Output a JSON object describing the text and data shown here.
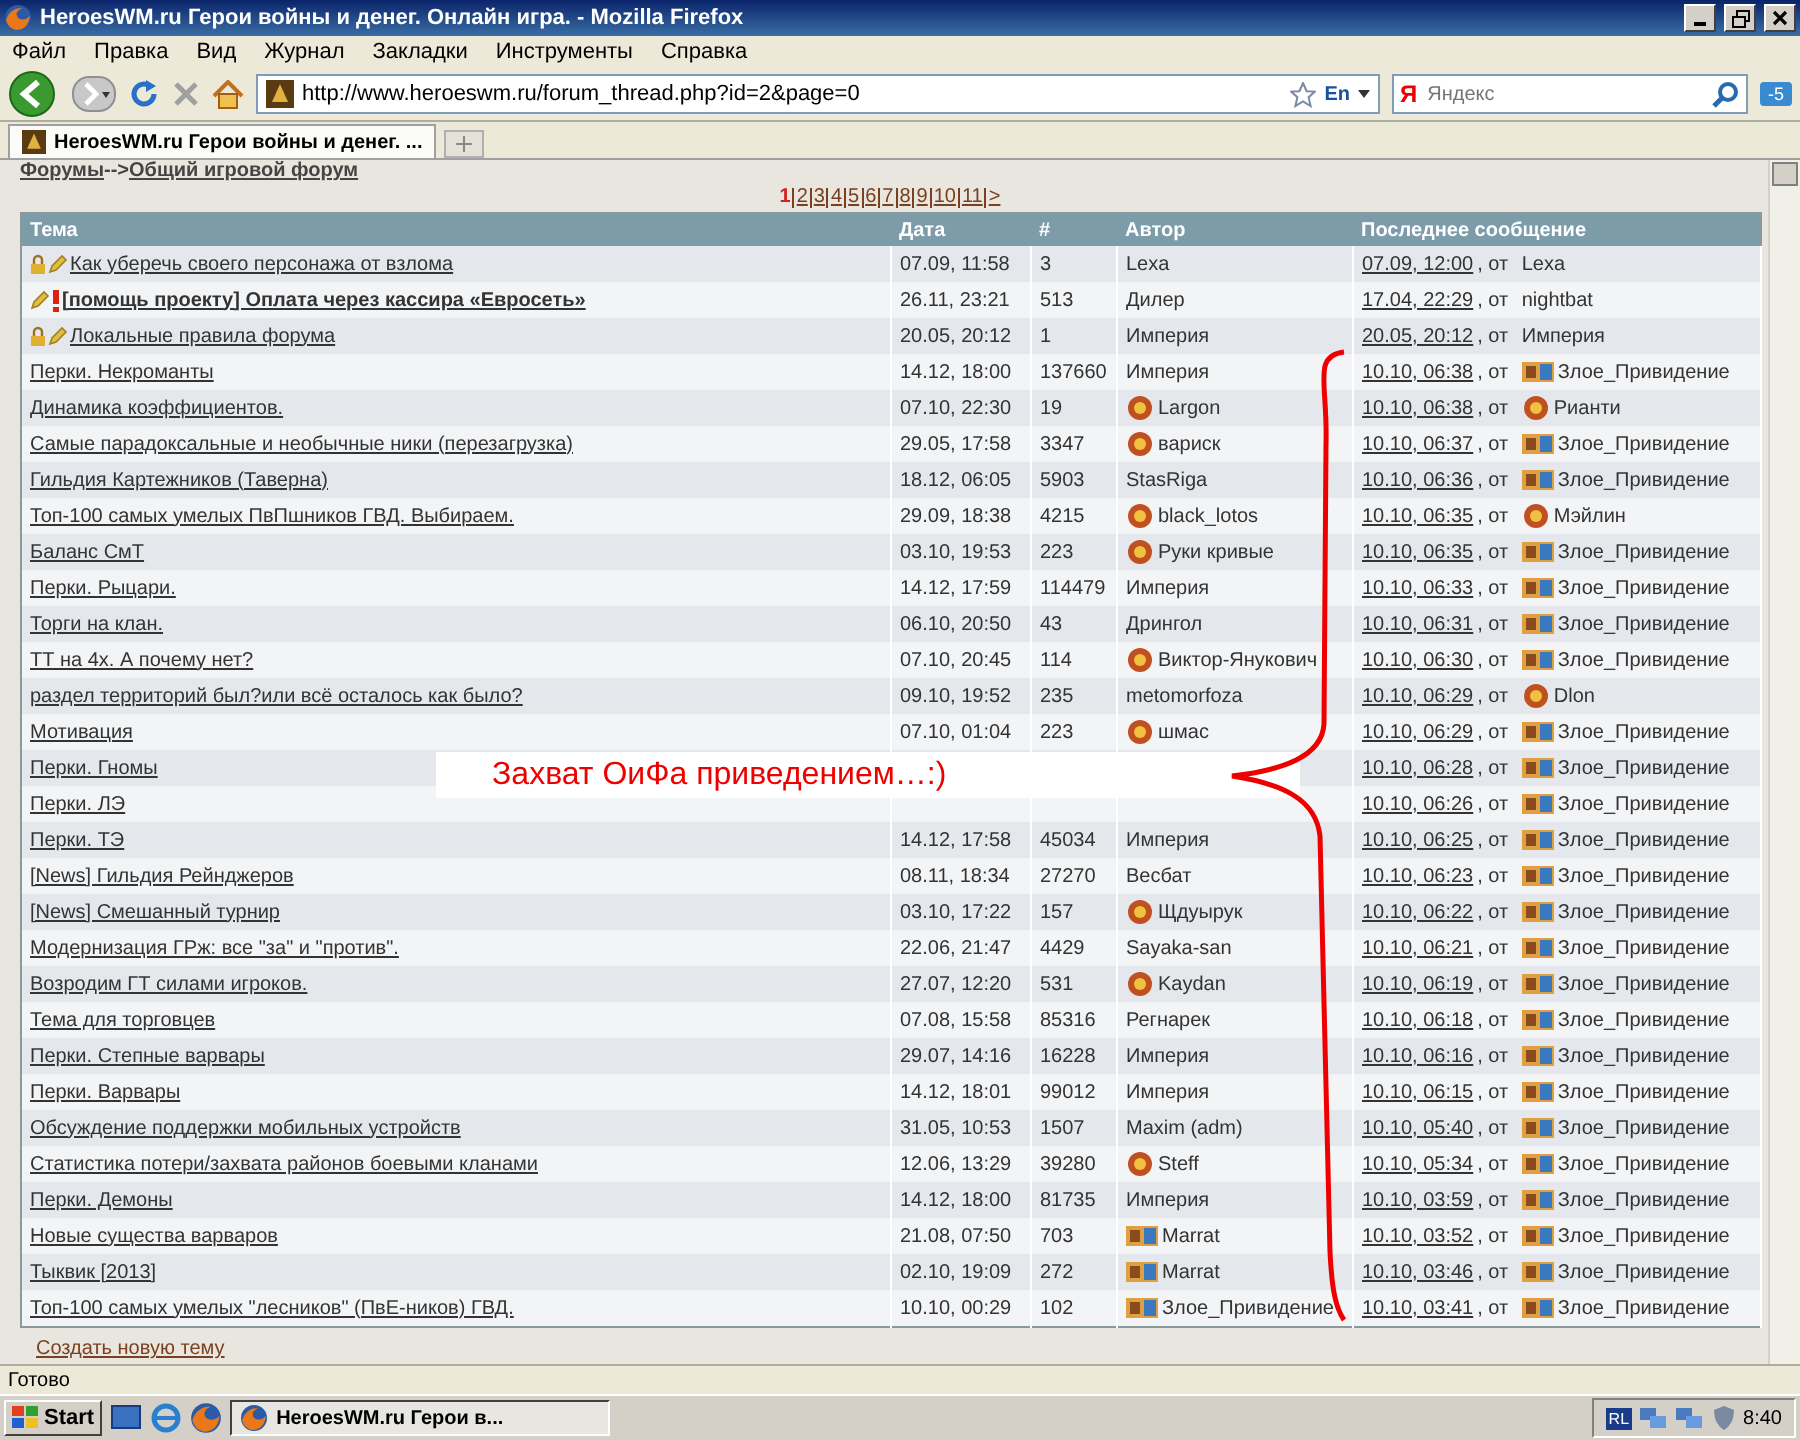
{
  "window": {
    "title": "HeroesWM.ru Герои войны и денег. Онлайн игра. - Mozilla Firefox"
  },
  "menu": [
    "Файл",
    "Правка",
    "Вид",
    "Журнал",
    "Закладки",
    "Инструменты",
    "Справка"
  ],
  "toolbar": {
    "url": "http://www.heroeswm.ru/forum_thread.php?id=2&page=0",
    "lang": "En",
    "search_logo": "Я",
    "search_placeholder": "Яндекс",
    "badge": "-5"
  },
  "tabs": [
    {
      "label": "HeroesWM.ru Герои войны и денег. ...",
      "selected": true
    }
  ],
  "breadcrumb": {
    "root": "Форумы",
    "sep": "-->",
    "current": "Общий игровой форум"
  },
  "pages": {
    "items": [
      {
        "label": "1",
        "selected": true
      },
      {
        "label": "2",
        "selected": false
      },
      {
        "label": "3",
        "selected": false
      },
      {
        "label": "4",
        "selected": false
      },
      {
        "label": "5",
        "selected": false
      },
      {
        "label": "6",
        "selected": false
      },
      {
        "label": "7",
        "selected": false
      },
      {
        "label": "8",
        "selected": false
      },
      {
        "label": "9",
        "selected": false
      },
      {
        "label": "10",
        "selected": false
      },
      {
        "label": "11",
        "selected": false
      }
    ],
    "next": ">"
  },
  "table": {
    "columns": [
      "Тема",
      "Дата",
      "#",
      "Автор",
      "Последнее сообщение"
    ],
    "rows": [
      {
        "kind": "locked",
        "title": "Как уберечь своего персонажа от взлома",
        "date": "07.09, 11:58",
        "count": "3",
        "author": {
          "kind": "plain",
          "name": "Lexa"
        },
        "last": {
          "time": "07.09, 12:00",
          "sep": ", от",
          "kind": "plain",
          "author": "Lexa"
        }
      },
      {
        "kind": "important",
        "title": "[помощь проекту] Оплата через кассира «Евросеть»",
        "date": "26.11, 23:21",
        "count": "513",
        "author": {
          "kind": "plain",
          "name": "Дилер"
        },
        "last": {
          "time": "17.04, 22:29",
          "sep": ", от",
          "kind": "plain",
          "author": "nightbat"
        }
      },
      {
        "kind": "locked",
        "title": "Локальные правила форума",
        "date": "20.05, 20:12",
        "count": "1",
        "author": {
          "kind": "plain",
          "name": "Империя"
        },
        "last": {
          "time": "20.05, 20:12",
          "sep": ", от",
          "kind": "plain",
          "author": "Империя"
        }
      },
      {
        "kind": "topic",
        "title": "Перки. Некроманты",
        "date": "14.12, 18:00",
        "count": "137660",
        "author": {
          "kind": "plain",
          "name": "Империя"
        },
        "last": {
          "time": "10.10, 06:38",
          "sep": ", от",
          "kind": "clan",
          "author": "Злое_Привидение"
        }
      },
      {
        "kind": "topic",
        "title": "Динамика коэффициентов.",
        "date": "07.10, 22:30",
        "count": "19",
        "author": {
          "kind": "emblem",
          "name": "Largon"
        },
        "last": {
          "time": "10.10, 06:38",
          "sep": ", от",
          "kind": "emblem",
          "author": "Рианти"
        }
      },
      {
        "kind": "topic",
        "title": "Самые парадоксальные и необычные ники (перезагрузка)",
        "date": "29.05, 17:58",
        "count": "3347",
        "author": {
          "kind": "emblem",
          "name": "вариск"
        },
        "last": {
          "time": "10.10, 06:37",
          "sep": ", от",
          "kind": "clan",
          "author": "Злое_Привидение"
        }
      },
      {
        "kind": "topic",
        "title": "Гильдия Картежников (Таверна)",
        "date": "18.12, 06:05",
        "count": "5903",
        "author": {
          "kind": "plain",
          "name": "StasRiga"
        },
        "last": {
          "time": "10.10, 06:36",
          "sep": ", от",
          "kind": "clan",
          "author": "Злое_Привидение"
        }
      },
      {
        "kind": "topic",
        "title": "Топ-100 самых умелых ПвПшников ГВД. Выбираем.",
        "date": "29.09, 18:38",
        "count": "4215",
        "author": {
          "kind": "emblem",
          "name": "black_lotos"
        },
        "last": {
          "time": "10.10, 06:35",
          "sep": ", от",
          "kind": "emblem",
          "author": "Мэйлин"
        }
      },
      {
        "kind": "topic",
        "title": "Баланс СмТ",
        "date": "03.10, 19:53",
        "count": "223",
        "author": {
          "kind": "emblem",
          "name": "Руки кривые"
        },
        "last": {
          "time": "10.10, 06:35",
          "sep": ", от",
          "kind": "clan",
          "author": "Злое_Привидение"
        }
      },
      {
        "kind": "topic",
        "title": "Перки. Рыцари.",
        "date": "14.12, 17:59",
        "count": "114479",
        "author": {
          "kind": "plain",
          "name": "Империя"
        },
        "last": {
          "time": "10.10, 06:33",
          "sep": ", от",
          "kind": "clan",
          "author": "Злое_Привидение"
        }
      },
      {
        "kind": "topic",
        "title": "Торги на клан.",
        "date": "06.10, 20:50",
        "count": "43",
        "author": {
          "kind": "plain",
          "name": "Дрингол"
        },
        "last": {
          "time": "10.10, 06:31",
          "sep": ", от",
          "kind": "clan",
          "author": "Злое_Привидение"
        }
      },
      {
        "kind": "topic",
        "title": "ТТ на 4х. А почему нет?",
        "date": "07.10, 20:45",
        "count": "114",
        "author": {
          "kind": "emblem",
          "name": "Виктор-Янукович"
        },
        "last": {
          "time": "10.10, 06:30",
          "sep": ", от",
          "kind": "clan",
          "author": "Злое_Привидение"
        }
      },
      {
        "kind": "topic",
        "title": "раздел территорий был?или всё осталось как было?",
        "date": "09.10, 19:52",
        "count": "235",
        "author": {
          "kind": "plain",
          "name": "metomorfoza"
        },
        "last": {
          "time": "10.10, 06:29",
          "sep": ", от",
          "kind": "emblem",
          "author": "Dlon"
        }
      },
      {
        "kind": "topic",
        "title": "Мотивация",
        "date": "07.10, 01:04",
        "count": "223",
        "author": {
          "kind": "emblem",
          "name": "шмас"
        },
        "last": {
          "time": "10.10, 06:29",
          "sep": ", от",
          "kind": "clan",
          "author": "Злое_Привидение"
        }
      },
      {
        "kind": "topic",
        "title": "Перки. Гномы",
        "last": {
          "time": "10.10, 06:28",
          "sep": ", от",
          "kind": "clan",
          "author": "Злое_Привидение"
        }
      },
      {
        "kind": "topic",
        "title": "Перки. ЛЭ",
        "last": {
          "time": "10.10, 06:26",
          "sep": ", от",
          "kind": "clan",
          "author": "Злое_Привидение"
        }
      },
      {
        "kind": "topic",
        "title": "Перки. ТЭ",
        "date": "14.12, 17:58",
        "count": "45034",
        "author": {
          "kind": "plain",
          "name": "Империя"
        },
        "last": {
          "time": "10.10, 06:25",
          "sep": ", от",
          "kind": "clan",
          "author": "Злое_Привидение"
        }
      },
      {
        "kind": "topic",
        "title": "[News] Гильдия Рейнджеров",
        "date": "08.11, 18:34",
        "count": "27270",
        "author": {
          "kind": "plain",
          "name": "Весбат"
        },
        "last": {
          "time": "10.10, 06:23",
          "sep": ", от",
          "kind": "clan",
          "author": "Злое_Привидение"
        }
      },
      {
        "kind": "topic",
        "title": "[News] Смешанный турнир",
        "date": "03.10, 17:22",
        "count": "157",
        "author": {
          "kind": "emblem",
          "name": "Щдуырук"
        },
        "last": {
          "time": "10.10, 06:22",
          "sep": ", от",
          "kind": "clan",
          "author": "Злое_Привидение"
        }
      },
      {
        "kind": "topic",
        "title": "Модернизация ГРж: все \"за\" и \"против\".",
        "date": "22.06, 21:47",
        "count": "4429",
        "author": {
          "kind": "plain",
          "name": "Sayaka-san"
        },
        "last": {
          "time": "10.10, 06:21",
          "sep": ", от",
          "kind": "clan",
          "author": "Злое_Привидение"
        }
      },
      {
        "kind": "topic",
        "title": "Возродим ГТ силами игроков.",
        "date": "27.07, 12:20",
        "count": "531",
        "author": {
          "kind": "emblem",
          "name": "Kaydan"
        },
        "last": {
          "time": "10.10, 06:19",
          "sep": ", от",
          "kind": "clan",
          "author": "Злое_Привидение"
        }
      },
      {
        "kind": "topic",
        "title": "Тема для торговцев",
        "date": "07.08, 15:58",
        "count": "85316",
        "author": {
          "kind": "plain",
          "name": "Регнарек"
        },
        "last": {
          "time": "10.10, 06:18",
          "sep": ", от",
          "kind": "clan",
          "author": "Злое_Привидение"
        }
      },
      {
        "kind": "topic",
        "title": "Перки. Степные варвары",
        "date": "29.07, 14:16",
        "count": "16228",
        "author": {
          "kind": "plain",
          "name": "Империя"
        },
        "last": {
          "time": "10.10, 06:16",
          "sep": ", от",
          "kind": "clan",
          "author": "Злое_Привидение"
        }
      },
      {
        "kind": "topic",
        "title": "Перки. Варвары",
        "date": "14.12, 18:01",
        "count": "99012",
        "author": {
          "kind": "plain",
          "name": "Империя"
        },
        "last": {
          "time": "10.10, 06:15",
          "sep": ", от",
          "kind": "clan",
          "author": "Злое_Привидение"
        }
      },
      {
        "kind": "topic",
        "title": "Обсуждение поддержки мобильных устройств",
        "date": "31.05, 10:53",
        "count": "1507",
        "author": {
          "kind": "plain",
          "name": "Maxim (adm)"
        },
        "last": {
          "time": "10.10, 05:40",
          "sep": ", от",
          "kind": "clan",
          "author": "Злое_Привидение"
        }
      },
      {
        "kind": "topic",
        "title": "Статистика потери/захвата районов боевыми кланами",
        "date": "12.06, 13:29",
        "count": "39280",
        "author": {
          "kind": "emblem",
          "name": "Steff"
        },
        "last": {
          "time": "10.10, 05:34",
          "sep": ", от",
          "kind": "clan",
          "author": "Злое_Привидение"
        }
      },
      {
        "kind": "topic",
        "title": "Перки. Демоны",
        "date": "14.12, 18:00",
        "count": "81735",
        "author": {
          "kind": "plain",
          "name": "Империя"
        },
        "last": {
          "time": "10.10, 03:59",
          "sep": ", от",
          "kind": "clan",
          "author": "Злое_Привидение"
        }
      },
      {
        "kind": "topic",
        "title": "Новые существа варваров",
        "date": "21.08, 07:50",
        "count": "703",
        "author": {
          "kind": "clan",
          "name": "Marrat"
        },
        "last": {
          "time": "10.10, 03:52",
          "sep": ", от",
          "kind": "clan",
          "author": "Злое_Привидение"
        }
      },
      {
        "kind": "topic",
        "title": "Тыквик [2013]",
        "date": "02.10, 19:09",
        "count": "272",
        "author": {
          "kind": "clan",
          "name": "Marrat"
        },
        "last": {
          "time": "10.10, 03:46",
          "sep": ", от",
          "kind": "clan",
          "author": "Злое_Привидение"
        }
      },
      {
        "kind": "topic",
        "title": "Топ-100 самых умелых \"лесников\" (ПвЕ-ников) ГВД.",
        "date": "10.10, 00:29",
        "count": "102",
        "author": {
          "kind": "clan",
          "name": "Злое_Привидение"
        },
        "last": {
          "time": "10.10, 03:41",
          "sep": ", от",
          "kind": "clan",
          "author": "Злое_Привидение"
        }
      }
    ]
  },
  "annotation": {
    "text": "Захват ОиФа приведением…:)"
  },
  "new_topic": "Создать новую тему",
  "status_bar": "Готово",
  "taskbar": {
    "start": "Start",
    "tasks": [
      {
        "label": "HeroesWM.ru Герои в...",
        "selected": true
      }
    ],
    "tray_lang": "RL",
    "clock": "8:40"
  }
}
